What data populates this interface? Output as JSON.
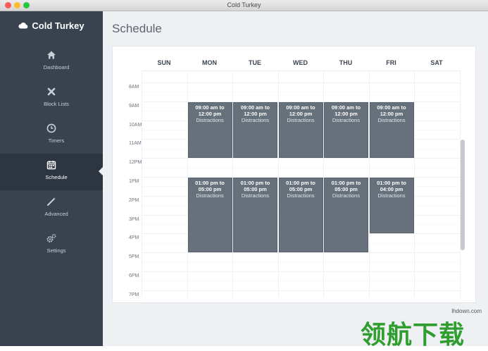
{
  "window": {
    "title": "Cold Turkey"
  },
  "sidebar": {
    "app_title": "Cold Turkey",
    "items": [
      {
        "label": "Dashboard",
        "icon": "home-icon"
      },
      {
        "label": "Block Lists",
        "icon": "x-icon"
      },
      {
        "label": "Timers",
        "icon": "clock-icon"
      },
      {
        "label": "Schedule",
        "icon": "calendar-icon",
        "active": true
      },
      {
        "label": "Advanced",
        "icon": "wand-icon"
      },
      {
        "label": "Settings",
        "icon": "gears-icon"
      }
    ]
  },
  "main": {
    "title": "Schedule"
  },
  "schedule": {
    "days": [
      "SUN",
      "MON",
      "TUE",
      "WED",
      "THU",
      "FRI",
      "SAT"
    ],
    "hours": [
      "8AM",
      "9AM",
      "10AM",
      "11AM",
      "12PM",
      "1PM",
      "2PM",
      "3PM",
      "4PM",
      "5PM",
      "6PM",
      "7PM"
    ],
    "blocks": [
      {
        "day": "MON",
        "time": "09:00 am to 12:00 pm",
        "name": "Distractions"
      },
      {
        "day": "TUE",
        "time": "09:00 am to 12:00 pm",
        "name": "Distractions"
      },
      {
        "day": "WED",
        "time": "09:00 am to 12:00 pm",
        "name": "Distractions"
      },
      {
        "day": "THU",
        "time": "09:00 am to 12:00 pm",
        "name": "Distractions"
      },
      {
        "day": "FRI",
        "time": "09:00 am to 12:00 pm",
        "name": "Distractions"
      },
      {
        "day": "MON",
        "time": "01:00 pm to 05:00 pm",
        "name": "Distractions"
      },
      {
        "day": "TUE",
        "time": "01:00 pm to 05:00 pm",
        "name": "Distractions"
      },
      {
        "day": "WED",
        "time": "01:00 pm to 05:00 pm",
        "name": "Distractions"
      },
      {
        "day": "THU",
        "time": "01:00 pm to 05:00 pm",
        "name": "Distractions"
      },
      {
        "day": "FRI",
        "time": "01:00 pm to 04:00 pm",
        "name": "Distractions"
      }
    ]
  },
  "watermark": {
    "url": "lhdown.com",
    "text": "领航下载"
  },
  "colors": {
    "sidebar": "#38434f",
    "sidebar_active": "#2d3640",
    "block": "#67717b",
    "accent_title": "#5c6670"
  }
}
